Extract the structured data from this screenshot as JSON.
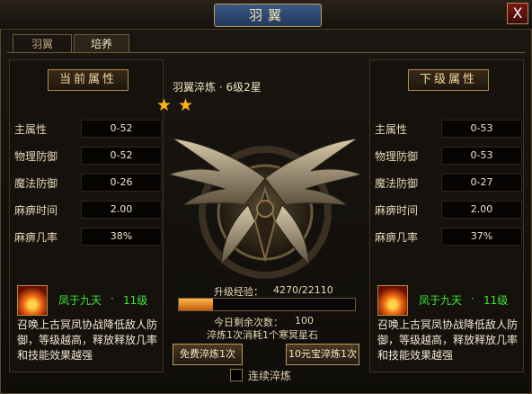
{
  "window": {
    "title": "羽翼",
    "close_label": "X"
  },
  "tabs": [
    {
      "label": "羽翼",
      "active": false
    },
    {
      "label": "培养",
      "active": true
    }
  ],
  "current": {
    "title": "当前属性",
    "attributes": [
      {
        "name": "主属性",
        "value": "0-52"
      },
      {
        "name": "物理防御",
        "value": "0-52"
      },
      {
        "name": "魔法防御",
        "value": "0-26"
      },
      {
        "name": "麻痹时间",
        "value": "2.00"
      },
      {
        "name": "麻痹几率",
        "value": "38%"
      }
    ],
    "skill": {
      "name": "凤于九天",
      "dot": "·",
      "level": "11级",
      "description": "召唤上古冥凤协战降低敌人防御，等级越高，释放释放几率和技能效果越强"
    }
  },
  "next": {
    "title": "下级属性",
    "attributes": [
      {
        "name": "主属性",
        "value": "0-53"
      },
      {
        "name": "物理防御",
        "value": "0-53"
      },
      {
        "name": "魔法防御",
        "value": "0-27"
      },
      {
        "name": "麻痹时间",
        "value": "2.00"
      },
      {
        "name": "麻痹几率",
        "value": "37%"
      }
    ],
    "skill": {
      "name": "凤于九天",
      "dot": "·",
      "level": "11级",
      "description": "召唤上古冥凤协战降低敌人防御，等级越高，释放释放几率和技能效果越强"
    }
  },
  "forge": {
    "title": "羽翼淬炼 · 6级2星",
    "stars": 2,
    "exp_label": "升级经验：",
    "exp_value": "4270/22110",
    "exp_fraction": 0.193,
    "remaining_label": "今日剩余次数：",
    "remaining_value": "100",
    "cost_text": "淬炼1次消耗1个寒冥星石",
    "free_button": "免费淬炼1次",
    "pay_button": "10元宝淬炼1次",
    "continuous_label": "连续淬炼",
    "continuous_checked": false
  },
  "colors": {
    "skill_green": "#3ee636",
    "gold_star": "#ffb316",
    "exp_bar": "#f0892c"
  }
}
